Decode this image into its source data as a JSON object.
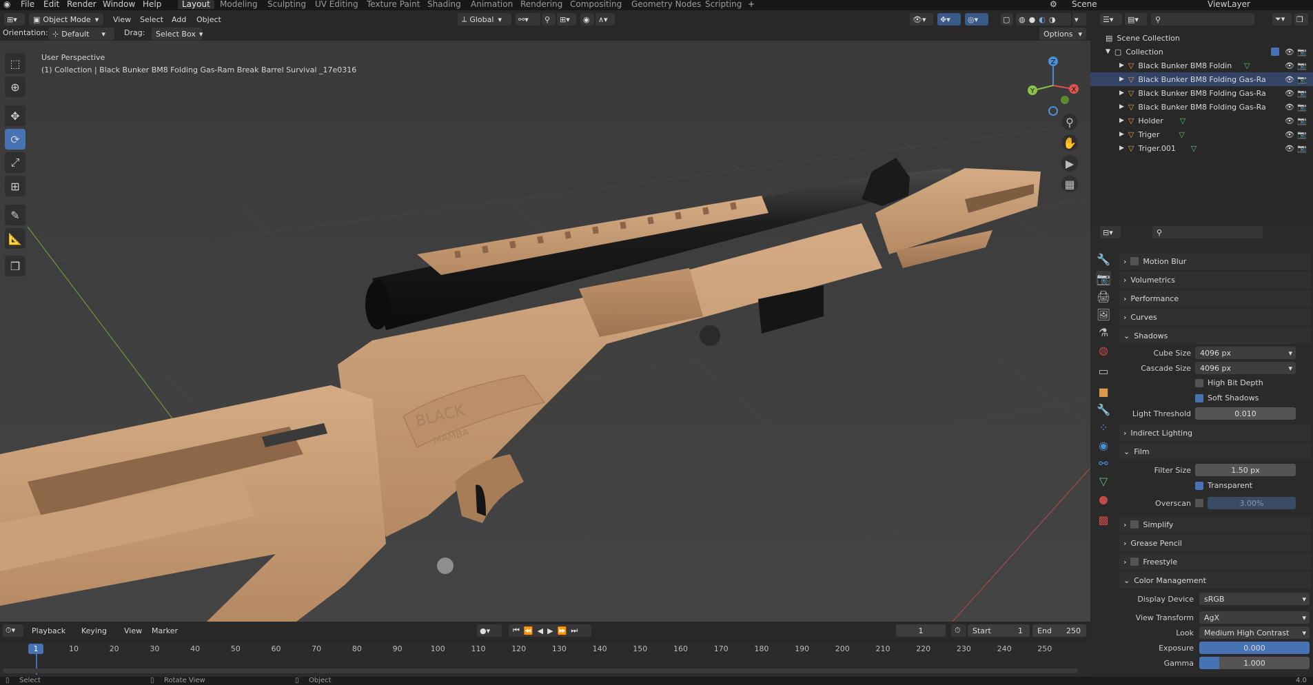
{
  "menus": [
    "File",
    "Edit",
    "Render",
    "Window",
    "Help"
  ],
  "workspaces": [
    "Layout",
    "Modeling",
    "Sculpting",
    "UV Editing",
    "Texture Paint",
    "Shading",
    "Animation",
    "Rendering",
    "Compositing",
    "Geometry Nodes",
    "Scripting"
  ],
  "active_workspace": "Layout",
  "add_workspace": "+",
  "scene_name": "Scene",
  "view_layer": "ViewLayer",
  "header": {
    "mode": "Object Mode",
    "menus": [
      "View",
      "Select",
      "Add",
      "Object"
    ],
    "transform_orientation": "Global",
    "orientation_label": "Orientation:",
    "orientation_value": "Default",
    "drag_label": "Drag:",
    "drag_value": "Select Box",
    "options": "Options"
  },
  "viewport": {
    "view_name": "User Perspective",
    "collection_info": "(1) Collection | Black Bunker BM8 Folding Gas-Ram Break Barrel Survival _17e0316",
    "model_text_brand": "BLACK",
    "model_text_sub": "MAMBA",
    "gizmo_axes": [
      "X",
      "Y",
      "Z"
    ]
  },
  "outliner": {
    "root": "Scene Collection",
    "collection": "Collection",
    "items": [
      "Black Bunker BM8 Foldin",
      "Black Bunker BM8 Folding Gas-Ra",
      "Black Bunker BM8 Folding Gas-Ra",
      "Black Bunker BM8 Folding Gas-Ra",
      "Holder",
      "Triger",
      "Triger.001"
    ]
  },
  "properties": {
    "sections": {
      "motion_blur": "Motion Blur",
      "volumetrics": "Volumetrics",
      "performance": "Performance",
      "curves": "Curves",
      "shadows": "Shadows",
      "indirect": "Indirect Lighting",
      "film": "Film",
      "simplify": "Simplify",
      "grease_pencil": "Grease Pencil",
      "freestyle": "Freestyle",
      "color_management": "Color Management"
    },
    "cube_size_label": "Cube Size",
    "cube_size": "4096 px",
    "cascade_size_label": "Cascade Size",
    "cascade_size": "4096 px",
    "high_bit_depth": "High Bit Depth",
    "soft_shadows": "Soft Shadows",
    "light_threshold_label": "Light Threshold",
    "light_threshold": "0.010",
    "filter_size_label": "Filter Size",
    "filter_size": "1.50 px",
    "transparent": "Transparent",
    "overscan_label": "Overscan",
    "overscan": "3.00%",
    "display_device_label": "Display Device",
    "display_device": "sRGB",
    "view_transform_label": "View Transform",
    "view_transform": "AgX",
    "look_label": "Look",
    "look": "Medium High Contrast",
    "exposure_label": "Exposure",
    "exposure": "0.000",
    "gamma_label": "Gamma",
    "gamma": "1.000"
  },
  "timeline": {
    "menus": [
      "Playback",
      "Keying",
      "View",
      "Marker"
    ],
    "current_frame": "1",
    "start_label": "Start",
    "start": "1",
    "end_label": "End",
    "end": "250",
    "ruler": [
      "1",
      "10",
      "20",
      "30",
      "40",
      "50",
      "60",
      "70",
      "80",
      "90",
      "100",
      "110",
      "120",
      "130",
      "140",
      "150",
      "160",
      "170",
      "180",
      "190",
      "200",
      "210",
      "220",
      "230",
      "240",
      "250"
    ]
  },
  "status": {
    "select": "Select",
    "rotate_view": "Rotate View",
    "object": "Object",
    "version": "4.0"
  },
  "colors": {
    "accent": "#4772b3",
    "tan": "#c49a73",
    "viewport_bg": "#3c3c3c",
    "x_axis": "#d9534f",
    "y_axis": "#8bc34a",
    "z_axis": "#4a8fd9"
  }
}
